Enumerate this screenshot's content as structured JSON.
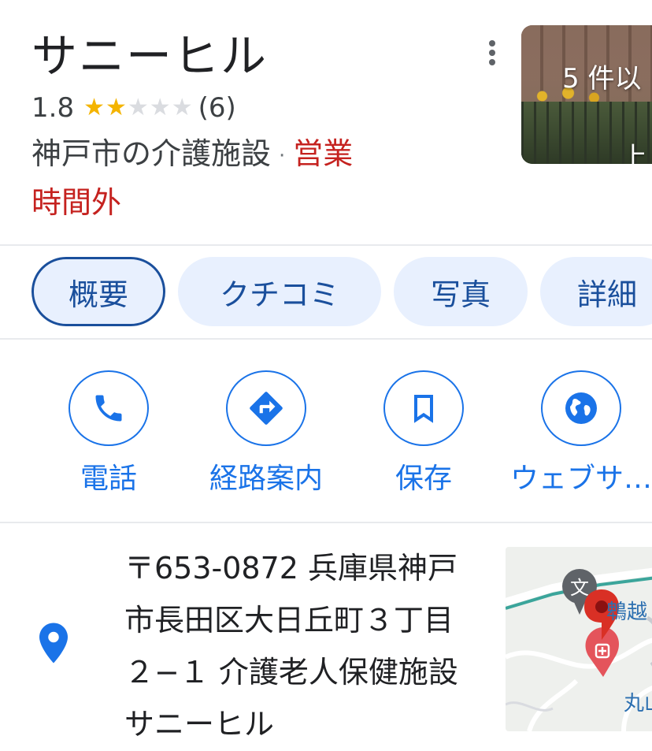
{
  "place": {
    "title": "サニーヒル",
    "rating": "1.8",
    "stars_filled": 2,
    "stars_total": 5,
    "review_count": "(6)",
    "category": "神戸市の介護施設",
    "separator": "·",
    "status_line1": "営業",
    "status_line2": "時間外",
    "photo_label_1": "5 件以",
    "photo_label_2": "上"
  },
  "icons": {
    "more": "more-vert-icon",
    "star_full": "★",
    "star_empty": "★"
  },
  "tabs": [
    {
      "label": "概要",
      "active": true
    },
    {
      "label": "クチコミ",
      "active": false
    },
    {
      "label": "写真",
      "active": false
    },
    {
      "label": "詳細",
      "active": false
    }
  ],
  "actions": [
    {
      "label": "電話",
      "icon": "phone-icon"
    },
    {
      "label": "経路案内",
      "icon": "directions-icon"
    },
    {
      "label": "保存",
      "icon": "bookmark-icon"
    },
    {
      "label": "ウェブサ…",
      "icon": "globe-icon"
    }
  ],
  "address": {
    "text": "〒653-0872 兵庫県神戸市長田区大日丘町３丁目２−１ 介護老人保健施設サニーヒル",
    "map_label_1": "鵯越",
    "map_label_2": "丸山",
    "map_school_glyph": "文"
  },
  "colors": {
    "accent": "#1a73e8",
    "tab_text": "#1a4f9c",
    "tab_bg": "#e8f0fe",
    "closed": "#c5221f",
    "star": "#f4b400",
    "pin": "#d93025"
  }
}
